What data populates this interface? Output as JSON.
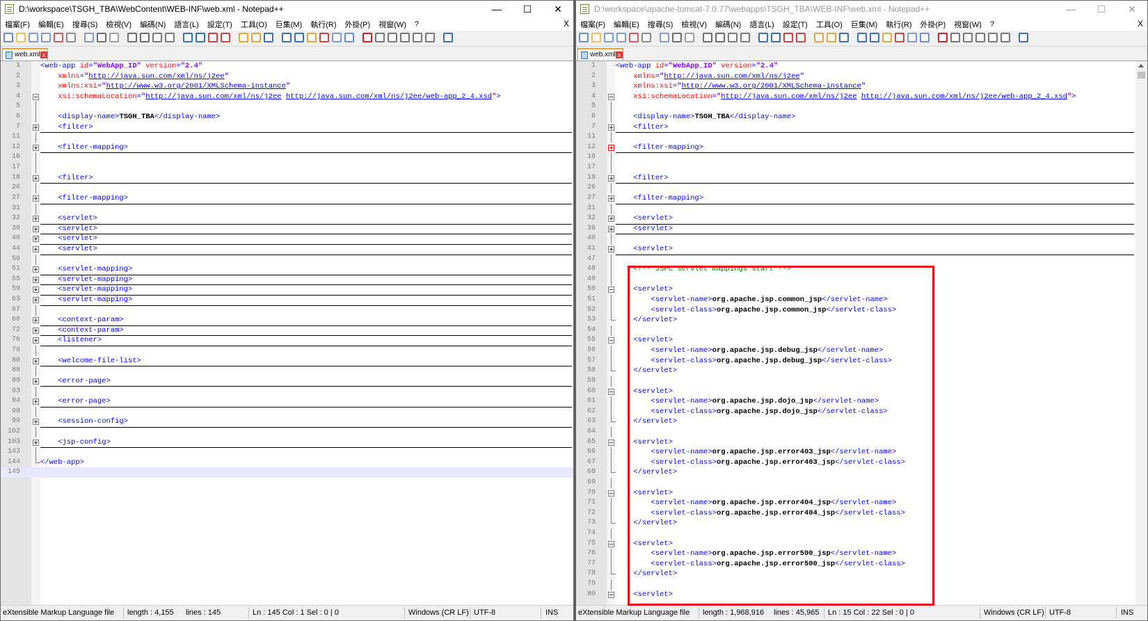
{
  "left": {
    "title": "D:\\workspace\\TSGH_TBA\\WebContent\\WEB-INF\\web.xml - Notepad++",
    "tab_label": "web.xml",
    "status": {
      "lang": "eXtensible Markup Language file",
      "length": "length : 4,155",
      "lines": "lines : 145",
      "pos": "Ln : 145    Col : 1    Sel : 0 | 0",
      "eol": "Windows (CR LF)",
      "enc": "UTF-8",
      "ins": "INS"
    }
  },
  "right": {
    "title": "D:\\workspace\\apache-tomcat-7.0.77\\webapps\\TSGH_TBA\\WEB-INF\\web.xml - Notepad++",
    "tab_label": "web.xml",
    "status": {
      "lang": "eXtensible Markup Language file",
      "length": "length : 1,968,916",
      "lines": "lines : 45,965",
      "pos": "Ln : 15    Col : 22    Sel : 0 | 0",
      "eol": "Windows (CR LF)",
      "enc": "UTF-8",
      "ins": "INS"
    }
  },
  "menu": [
    "檔案(F)",
    "編輯(E)",
    "搜尋(S)",
    "檢視(V)",
    "編碼(N)",
    "語言(L)",
    "設定(T)",
    "工具(O)",
    "巨集(M)",
    "執行(R)",
    "外掛(P)",
    "視窗(W)",
    "?"
  ],
  "window_buttons": {
    "minimize": "—",
    "maximize": "☐",
    "close": "✕"
  },
  "menu_close": "X",
  "colors": {
    "highlight_box": "#e8101a",
    "tag": "#0000ff",
    "attribute": "#ff0000",
    "value": "#8000ff",
    "comment": "#008000"
  },
  "left_code": [
    {
      "n": "1",
      "c": [
        [
          "t",
          "<web-app "
        ],
        [
          "a",
          "id"
        ],
        [
          "t",
          "="
        ],
        [
          "v",
          "\"WebApp_ID\""
        ],
        [
          "a",
          " version"
        ],
        [
          "t",
          "="
        ],
        [
          "v",
          "\"2.4\""
        ]
      ]
    },
    {
      "n": "2",
      "c": [
        [
          "p",
          "    "
        ],
        [
          "a",
          "xmlns"
        ],
        [
          "t",
          "="
        ],
        [
          "v",
          "\""
        ],
        [
          "u",
          "http://java.sun.com/xml/ns/j2ee"
        ],
        [
          "v",
          "\""
        ]
      ]
    },
    {
      "n": "3",
      "c": [
        [
          "p",
          "    "
        ],
        [
          "a",
          "xmlns:xsi"
        ],
        [
          "t",
          "="
        ],
        [
          "v",
          "\""
        ],
        [
          "u",
          "http://www.w3.org/2001/XMLSchema-instance"
        ],
        [
          "v",
          "\""
        ]
      ]
    },
    {
      "n": "4",
      "f": "m",
      "c": [
        [
          "p",
          "    "
        ],
        [
          "a",
          "xsi:schemaLocation"
        ],
        [
          "t",
          "="
        ],
        [
          "v",
          "\""
        ],
        [
          "u",
          "http://java.sun.com/xml/ns/j2ee"
        ],
        [
          "p",
          " "
        ],
        [
          "u",
          "http://java.sun.com/xml/ns/j2ee/web-app_2_4.xsd"
        ],
        [
          "v",
          "\""
        ],
        [
          "t",
          ">"
        ]
      ]
    },
    {
      "n": "5",
      "f": "v",
      "c": []
    },
    {
      "n": "6",
      "f": "v",
      "c": [
        [
          "p",
          "    "
        ],
        [
          "t",
          "<display-name>"
        ],
        [
          "x",
          "TSGH_TBA"
        ],
        [
          "t",
          "</display-name>"
        ]
      ]
    },
    {
      "n": "7",
      "f": "p",
      "l": 1,
      "c": [
        [
          "p",
          "    "
        ],
        [
          "t",
          "<filter>"
        ]
      ]
    },
    {
      "n": "11",
      "f": "v",
      "c": []
    },
    {
      "n": "12",
      "f": "p",
      "l": 1,
      "c": [
        [
          "p",
          "    "
        ],
        [
          "t",
          "<filter-mapping>"
        ]
      ]
    },
    {
      "n": "16",
      "f": "v",
      "c": [
        [
          "p",
          "    "
        ],
        [
          "t",
          "  "
        ]
      ]
    },
    {
      "n": "17",
      "f": "v",
      "c": [
        [
          "p",
          "    "
        ],
        [
          "t",
          "  "
        ]
      ]
    },
    {
      "n": "18",
      "f": "p",
      "l": 1,
      "c": [
        [
          "p",
          "    "
        ],
        [
          "t",
          "<filter>"
        ]
      ]
    },
    {
      "n": "26",
      "f": "v",
      "c": []
    },
    {
      "n": "27",
      "f": "p",
      "l": 1,
      "c": [
        [
          "p",
          "    "
        ],
        [
          "t",
          "<filter-mapping>"
        ]
      ]
    },
    {
      "n": "31",
      "f": "v",
      "c": []
    },
    {
      "n": "32",
      "f": "p",
      "l": 1,
      "c": [
        [
          "p",
          "    "
        ],
        [
          "t",
          "<servlet>"
        ]
      ]
    },
    {
      "n": "36",
      "f": "p",
      "l": 1,
      "c": [
        [
          "p",
          "    "
        ],
        [
          "t",
          "<servlet>"
        ]
      ]
    },
    {
      "n": "40",
      "f": "p",
      "l": 1,
      "c": [
        [
          "p",
          "    "
        ],
        [
          "t",
          "<servlet>"
        ]
      ]
    },
    {
      "n": "44",
      "f": "p",
      "l": 1,
      "c": [
        [
          "p",
          "    "
        ],
        [
          "t",
          "<servlet>"
        ]
      ]
    },
    {
      "n": "50",
      "f": "v",
      "c": []
    },
    {
      "n": "51",
      "f": "p",
      "l": 1,
      "c": [
        [
          "p",
          "    "
        ],
        [
          "t",
          "<servlet-mapping>"
        ]
      ]
    },
    {
      "n": "55",
      "f": "p",
      "l": 1,
      "c": [
        [
          "p",
          "    "
        ],
        [
          "t",
          "<servlet-mapping>"
        ]
      ]
    },
    {
      "n": "59",
      "f": "p",
      "l": 1,
      "c": [
        [
          "p",
          "    "
        ],
        [
          "t",
          "<servlet-mapping>"
        ]
      ]
    },
    {
      "n": "63",
      "f": "p",
      "l": 1,
      "c": [
        [
          "p",
          "    "
        ],
        [
          "t",
          "<servlet-mapping>"
        ]
      ]
    },
    {
      "n": "67",
      "f": "v",
      "c": []
    },
    {
      "n": "68",
      "f": "p",
      "l": 1,
      "c": [
        [
          "p",
          "    "
        ],
        [
          "t",
          "<context-param>"
        ]
      ]
    },
    {
      "n": "72",
      "f": "p",
      "l": 1,
      "c": [
        [
          "p",
          "    "
        ],
        [
          "t",
          "<context-param>"
        ]
      ]
    },
    {
      "n": "76",
      "f": "p",
      "l": 1,
      "c": [
        [
          "p",
          "    "
        ],
        [
          "t",
          "<listener>"
        ]
      ]
    },
    {
      "n": "79",
      "f": "v",
      "c": []
    },
    {
      "n": "80",
      "f": "p",
      "l": 1,
      "c": [
        [
          "p",
          "    "
        ],
        [
          "t",
          "<welcome-file-list>"
        ]
      ]
    },
    {
      "n": "88",
      "f": "v",
      "c": []
    },
    {
      "n": "89",
      "f": "p",
      "l": 1,
      "c": [
        [
          "p",
          "    "
        ],
        [
          "t",
          "<error-page>"
        ]
      ]
    },
    {
      "n": "93",
      "f": "v",
      "c": []
    },
    {
      "n": "94",
      "f": "p",
      "l": 1,
      "c": [
        [
          "p",
          "    "
        ],
        [
          "t",
          "<error-page>"
        ]
      ]
    },
    {
      "n": "98",
      "f": "v",
      "c": []
    },
    {
      "n": "99",
      "f": "p",
      "l": 1,
      "c": [
        [
          "p",
          "    "
        ],
        [
          "t",
          "<session-config>"
        ]
      ]
    },
    {
      "n": "102",
      "f": "v",
      "c": []
    },
    {
      "n": "103",
      "f": "p",
      "l": 1,
      "c": [
        [
          "p",
          "    "
        ],
        [
          "t",
          "<jsp-config>"
        ]
      ]
    },
    {
      "n": "143",
      "f": "v",
      "c": []
    },
    {
      "n": "144",
      "f": "e",
      "c": [
        [
          "t",
          "</web-app>"
        ]
      ]
    },
    {
      "n": "145",
      "cur": 1,
      "c": []
    }
  ],
  "right_code": [
    {
      "n": "1",
      "c": [
        [
          "t",
          "<web-app "
        ],
        [
          "a",
          "id"
        ],
        [
          "t",
          "="
        ],
        [
          "v",
          "\"WebApp_ID\""
        ],
        [
          "a",
          " version"
        ],
        [
          "t",
          "="
        ],
        [
          "v",
          "\"2.4\""
        ]
      ]
    },
    {
      "n": "2",
      "c": [
        [
          "p",
          "    "
        ],
        [
          "a",
          "xmlns"
        ],
        [
          "t",
          "="
        ],
        [
          "v",
          "\""
        ],
        [
          "u",
          "http://java.sun.com/xml/ns/j2ee"
        ],
        [
          "v",
          "\""
        ]
      ]
    },
    {
      "n": "3",
      "c": [
        [
          "p",
          "    "
        ],
        [
          "a",
          "xmlns:xsi"
        ],
        [
          "t",
          "="
        ],
        [
          "v",
          "\""
        ],
        [
          "u",
          "http://www.w3.org/2001/XMLSchema-instance"
        ],
        [
          "v",
          "\""
        ]
      ]
    },
    {
      "n": "4",
      "f": "m",
      "c": [
        [
          "p",
          "    "
        ],
        [
          "a",
          "xsi:schemaLocation"
        ],
        [
          "t",
          "="
        ],
        [
          "v",
          "\""
        ],
        [
          "u",
          "http://java.sun.com/xml/ns/j2ee"
        ],
        [
          "p",
          " "
        ],
        [
          "u",
          "http://java.sun.com/xml/ns/j2ee/web-app_2_4.xsd"
        ],
        [
          "v",
          "\""
        ],
        [
          "t",
          ">"
        ]
      ]
    },
    {
      "n": "5",
      "f": "v",
      "c": []
    },
    {
      "n": "6",
      "f": "v",
      "c": [
        [
          "p",
          "    "
        ],
        [
          "t",
          "<display-name>"
        ],
        [
          "x",
          "TSGH_TBA"
        ],
        [
          "t",
          "</display-name>"
        ]
      ]
    },
    {
      "n": "7",
      "f": "p",
      "l": 1,
      "c": [
        [
          "p",
          "    "
        ],
        [
          "t",
          "<filter>"
        ]
      ]
    },
    {
      "n": "11",
      "f": "v",
      "c": []
    },
    {
      "n": "12",
      "f": "r",
      "l": 1,
      "c": [
        [
          "p",
          "    "
        ],
        [
          "t",
          "<filter-mapping>"
        ]
      ]
    },
    {
      "n": "16",
      "f": "v",
      "c": [
        [
          "p",
          "    "
        ],
        [
          "t",
          "  "
        ]
      ]
    },
    {
      "n": "17",
      "f": "v",
      "c": [
        [
          "p",
          "    "
        ],
        [
          "t",
          "  "
        ]
      ]
    },
    {
      "n": "18",
      "f": "p",
      "l": 1,
      "c": [
        [
          "p",
          "    "
        ],
        [
          "t",
          "<filter>"
        ]
      ]
    },
    {
      "n": "26",
      "f": "v",
      "c": []
    },
    {
      "n": "27",
      "f": "p",
      "l": 1,
      "c": [
        [
          "p",
          "    "
        ],
        [
          "t",
          "<filter-mapping>"
        ]
      ]
    },
    {
      "n": "31",
      "f": "v",
      "c": []
    },
    {
      "n": "32",
      "f": "p",
      "l": 1,
      "c": [
        [
          "p",
          "    "
        ],
        [
          "t",
          "<servlet>"
        ]
      ]
    },
    {
      "n": "36",
      "f": "p",
      "l": 1,
      "c": [
        [
          "p",
          "    "
        ],
        [
          "t",
          "<servlet>"
        ]
      ]
    },
    {
      "n": "40",
      "f": "v",
      "c": []
    },
    {
      "n": "41",
      "f": "p",
      "l": 1,
      "c": [
        [
          "p",
          "    "
        ],
        [
          "t",
          "<servlet>"
        ]
      ]
    },
    {
      "n": "47",
      "f": "v",
      "c": []
    },
    {
      "n": "48",
      "f": "v",
      "c": [
        [
          "p",
          "    "
        ],
        [
          "g",
          "<!-- JSPC servlet mappings start -->"
        ]
      ]
    },
    {
      "n": "49",
      "f": "v",
      "c": []
    },
    {
      "n": "50",
      "f": "m",
      "c": [
        [
          "p",
          "    "
        ],
        [
          "t",
          "<servlet>"
        ]
      ]
    },
    {
      "n": "51",
      "f": "v",
      "c": [
        [
          "p",
          "        "
        ],
        [
          "t",
          "<servlet-name>"
        ],
        [
          "x",
          "org.apache.jsp.common_jsp"
        ],
        [
          "t",
          "</servlet-name>"
        ]
      ]
    },
    {
      "n": "52",
      "f": "v",
      "c": [
        [
          "p",
          "        "
        ],
        [
          "t",
          "<servlet-class>"
        ],
        [
          "x",
          "org.apache.jsp.common_jsp"
        ],
        [
          "t",
          "</servlet-class>"
        ]
      ]
    },
    {
      "n": "53",
      "f": "e",
      "c": [
        [
          "p",
          "    "
        ],
        [
          "t",
          "</servlet>"
        ]
      ]
    },
    {
      "n": "54",
      "f": "v",
      "c": []
    },
    {
      "n": "55",
      "f": "m",
      "c": [
        [
          "p",
          "    "
        ],
        [
          "t",
          "<servlet>"
        ]
      ]
    },
    {
      "n": "56",
      "f": "v",
      "c": [
        [
          "p",
          "        "
        ],
        [
          "t",
          "<servlet-name>"
        ],
        [
          "x",
          "org.apache.jsp.debug_jsp"
        ],
        [
          "t",
          "</servlet-name>"
        ]
      ]
    },
    {
      "n": "57",
      "f": "v",
      "c": [
        [
          "p",
          "        "
        ],
        [
          "t",
          "<servlet-class>"
        ],
        [
          "x",
          "org.apache.jsp.debug_jsp"
        ],
        [
          "t",
          "</servlet-class>"
        ]
      ]
    },
    {
      "n": "58",
      "f": "e",
      "c": [
        [
          "p",
          "    "
        ],
        [
          "t",
          "</servlet>"
        ]
      ]
    },
    {
      "n": "59",
      "f": "v",
      "c": []
    },
    {
      "n": "60",
      "f": "m",
      "c": [
        [
          "p",
          "    "
        ],
        [
          "t",
          "<servlet>"
        ]
      ]
    },
    {
      "n": "61",
      "f": "v",
      "c": [
        [
          "p",
          "        "
        ],
        [
          "t",
          "<servlet-name>"
        ],
        [
          "x",
          "org.apache.jsp.dojo_jsp"
        ],
        [
          "t",
          "</servlet-name>"
        ]
      ]
    },
    {
      "n": "62",
      "f": "v",
      "c": [
        [
          "p",
          "        "
        ],
        [
          "t",
          "<servlet-class>"
        ],
        [
          "x",
          "org.apache.jsp.dojo_jsp"
        ],
        [
          "t",
          "</servlet-class>"
        ]
      ]
    },
    {
      "n": "63",
      "f": "e",
      "c": [
        [
          "p",
          "    "
        ],
        [
          "t",
          "</servlet>"
        ]
      ]
    },
    {
      "n": "64",
      "f": "v",
      "c": []
    },
    {
      "n": "65",
      "f": "m",
      "c": [
        [
          "p",
          "    "
        ],
        [
          "t",
          "<servlet>"
        ]
      ]
    },
    {
      "n": "66",
      "f": "v",
      "c": [
        [
          "p",
          "        "
        ],
        [
          "t",
          "<servlet-name>"
        ],
        [
          "x",
          "org.apache.jsp.error403_jsp"
        ],
        [
          "t",
          "</servlet-name>"
        ]
      ]
    },
    {
      "n": "67",
      "f": "v",
      "c": [
        [
          "p",
          "        "
        ],
        [
          "t",
          "<servlet-class>"
        ],
        [
          "x",
          "org.apache.jsp.error403_jsp"
        ],
        [
          "t",
          "</servlet-class>"
        ]
      ]
    },
    {
      "n": "68",
      "f": "e",
      "c": [
        [
          "p",
          "    "
        ],
        [
          "t",
          "</servlet>"
        ]
      ]
    },
    {
      "n": "69",
      "f": "v",
      "c": []
    },
    {
      "n": "70",
      "f": "m",
      "c": [
        [
          "p",
          "    "
        ],
        [
          "t",
          "<servlet>"
        ]
      ]
    },
    {
      "n": "71",
      "f": "v",
      "c": [
        [
          "p",
          "        "
        ],
        [
          "t",
          "<servlet-name>"
        ],
        [
          "x",
          "org.apache.jsp.error404_jsp"
        ],
        [
          "t",
          "</servlet-name>"
        ]
      ]
    },
    {
      "n": "72",
      "f": "v",
      "c": [
        [
          "p",
          "        "
        ],
        [
          "t",
          "<servlet-class>"
        ],
        [
          "x",
          "org.apache.jsp.error404_jsp"
        ],
        [
          "t",
          "</servlet-class>"
        ]
      ]
    },
    {
      "n": "73",
      "f": "e",
      "c": [
        [
          "p",
          "    "
        ],
        [
          "t",
          "</servlet>"
        ]
      ]
    },
    {
      "n": "74",
      "f": "v",
      "c": []
    },
    {
      "n": "75",
      "f": "m",
      "c": [
        [
          "p",
          "    "
        ],
        [
          "t",
          "<servlet>"
        ]
      ]
    },
    {
      "n": "76",
      "f": "v",
      "c": [
        [
          "p",
          "        "
        ],
        [
          "t",
          "<servlet-name>"
        ],
        [
          "x",
          "org.apache.jsp.error500_jsp"
        ],
        [
          "t",
          "</servlet-name>"
        ]
      ]
    },
    {
      "n": "77",
      "f": "v",
      "c": [
        [
          "p",
          "        "
        ],
        [
          "t",
          "<servlet-class>"
        ],
        [
          "x",
          "org.apache.jsp.error500_jsp"
        ],
        [
          "t",
          "</servlet-class>"
        ]
      ]
    },
    {
      "n": "78",
      "f": "e",
      "c": [
        [
          "p",
          "    "
        ],
        [
          "t",
          "</servlet>"
        ]
      ]
    },
    {
      "n": "79",
      "f": "v",
      "c": []
    },
    {
      "n": "80",
      "f": "m",
      "c": [
        [
          "p",
          "    "
        ],
        [
          "t",
          "<servlet>"
        ]
      ]
    }
  ]
}
